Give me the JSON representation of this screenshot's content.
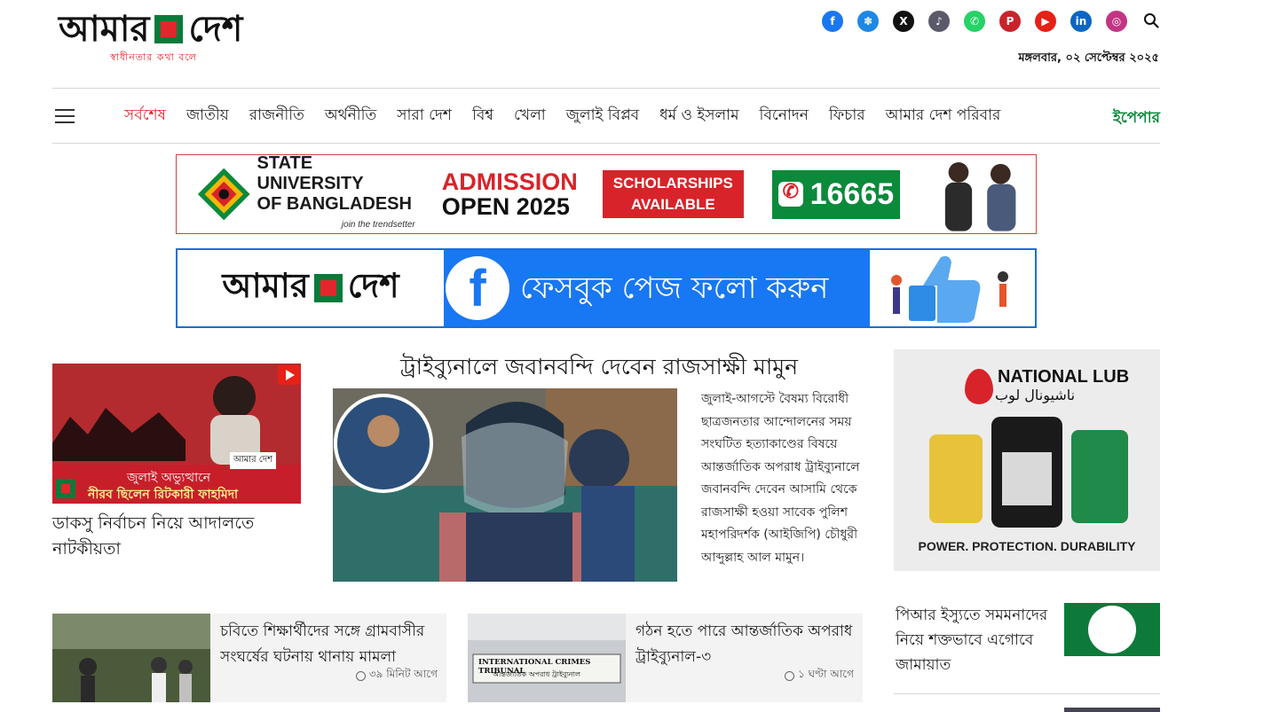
{
  "header": {
    "logo_left": "আমার",
    "logo_right": "দেশ",
    "tagline": "স্বাধীনতার কথা বলে",
    "date": "মঙ্গলবার, ০২ সেপ্টেম্বর ২০২৫",
    "socials": [
      {
        "name": "facebook-icon",
        "glyph": "f",
        "color": "#1877f2"
      },
      {
        "name": "community-icon",
        "glyph": "✽",
        "color": "#1e88e5"
      },
      {
        "name": "x-icon",
        "glyph": "X",
        "color": "#111111"
      },
      {
        "name": "tiktok-icon",
        "glyph": "♪",
        "color": "#5a5a6a"
      },
      {
        "name": "whatsapp-icon",
        "glyph": "✆",
        "color": "#25d366"
      },
      {
        "name": "pinterest-icon",
        "glyph": "P",
        "color": "#c8232c"
      },
      {
        "name": "youtube-icon",
        "glyph": "▶",
        "color": "#e62117"
      },
      {
        "name": "linkedin-icon",
        "glyph": "in",
        "color": "#0a66c2"
      },
      {
        "name": "instagram-icon",
        "glyph": "◎",
        "color": "#c13584"
      }
    ]
  },
  "nav": {
    "items": [
      "সর্বশেষ",
      "জাতীয়",
      "রাজনীতি",
      "অর্থনীতি",
      "সারা দেশ",
      "বিশ্ব",
      "খেলা",
      "জুলাই বিপ্লব",
      "ধর্ম ও ইসলাম",
      "বিনোদন",
      "ফিচার",
      "আমার দেশ পরিবার"
    ],
    "epaper": "ইপেপার"
  },
  "ad1": {
    "name_line1": "STATE UNIVERSITY",
    "name_line2": "OF BANGLADESH",
    "tagline": "join the trendsetter",
    "admission_line1": "ADMISSION",
    "admission_line2": "OPEN 2025",
    "scholar_line1": "SCHOLARSHIPS",
    "scholar_line2": "AVAILABLE",
    "phone": "16665"
  },
  "ad2": {
    "logo_left": "আমার",
    "logo_right": "দেশ",
    "text": "ফেসবুক পেজ ফলো করুন"
  },
  "left_story": {
    "overlay_top": "জুলাই অভ্যুত্থানে",
    "overlay_bottom": "নীরব ছিলেন রিটকারী ফাহমিদা",
    "brand": "আমার দেশ",
    "title": "ডাকসু নির্বাচন নিয়ে আদালতে নাটকীয়তা"
  },
  "lead_story": {
    "title": "ট্রাইব্যুনালে জবানবন্দি দেবেন রাজসাক্ষী মামুন",
    "summary": "জুলাই-আগস্টে বৈষম্য বিরোধী ছাত্রজনতার আন্দোলনের সময় সংঘটিত হত্যাকাণ্ডের বিষয়ে আন্তর্জাতিক অপরাধ ট্রাইব্যুনালে জবানবন্দি দেবেন আসামি থেকে রাজসাক্ষী হওয়া সাবেক পুলিশ মহাপরিদর্শক (আইজিপি) চৌধুরী আব্দুল্লাহ আল মামুন।"
  },
  "right_ad": {
    "brand": "NATIONAL LUB",
    "brand_arabic": "ناشيونال لوب",
    "footer": "POWER. PROTECTION. DURABILITY"
  },
  "cards": [
    {
      "title": "চবিতে শিক্ষার্থীদের সঙ্গে গ্রামবাসীর সংঘর্ষের ঘটনায় থানায় মামলা",
      "time": "৩৯ মিনিট আগে"
    },
    {
      "title": "গঠন হতে পারে আন্তর্জাতিক অপরাধ ট্রাইব্যুনাল-৩",
      "time": "১ ঘণ্টা আগে",
      "sign_line1": "INTERNATIONAL CRIMES TRIBUNAL",
      "sign_line2": "আন্তর্জাতিক অপরাধ ট্রাইব্যুনাল"
    }
  ],
  "side_story": {
    "title": "পিআর ইস্যুতে সমমনাদের নিয়ে শক্তভাবে এগোবে জামায়াত"
  }
}
